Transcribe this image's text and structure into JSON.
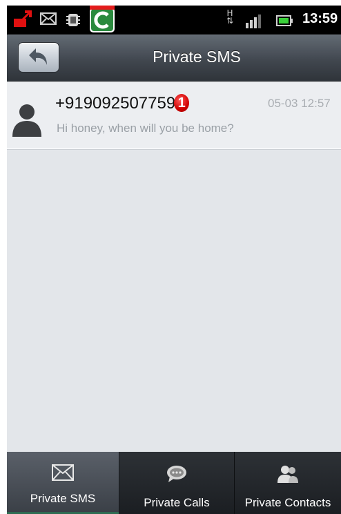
{
  "status_bar": {
    "icons": [
      "upload-icon",
      "mail-icon",
      "chip-icon",
      "app-icon",
      "h-data-icon",
      "signal-icon",
      "battery-icon"
    ],
    "network_label": "H",
    "time": "13:59"
  },
  "header": {
    "title": "Private SMS",
    "back_icon": "back-arrow-icon"
  },
  "messages": [
    {
      "sender": "+919092507759",
      "unread_count": "1",
      "time": "05-03 12:57",
      "preview": "Hi honey, when will you be home?"
    }
  ],
  "tabs": [
    {
      "label": "Private SMS",
      "icon": "envelope-icon",
      "selected": true
    },
    {
      "label": "Private Calls",
      "icon": "chat-bubble-icon",
      "selected": false
    },
    {
      "label": "Private Contacts",
      "icon": "contacts-icon",
      "selected": false
    }
  ],
  "colors": {
    "header_bg": "#41474f",
    "list_bg": "#e3e6ea",
    "badge": "#d10000",
    "tab_selected": "#4a5058",
    "tab_bg": "#1f2226"
  }
}
